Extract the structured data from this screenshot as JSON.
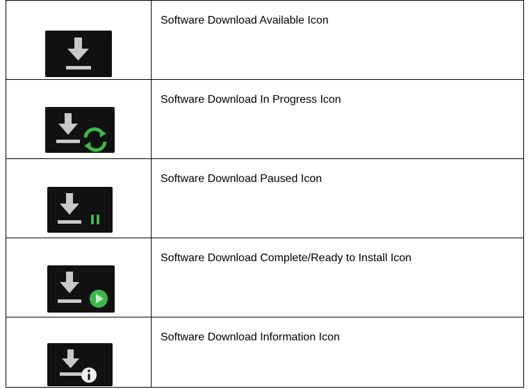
{
  "rows": [
    {
      "icon": "download-available-icon",
      "label": "Software Download Available Icon"
    },
    {
      "icon": "download-in-progress-icon",
      "label": "Software Download In Progress Icon"
    },
    {
      "icon": "download-paused-icon",
      "label": "Software Download Paused Icon"
    },
    {
      "icon": "download-complete-icon",
      "label": "Software Download Complete/Ready to Install Icon"
    },
    {
      "icon": "download-information-icon",
      "label": "Software Download Information Icon"
    }
  ],
  "colors": {
    "icon_background": "#111111",
    "arrow": "#c8c8c8",
    "status_green": "#3fb84b",
    "info_white": "#f0f0f0",
    "border": "#000000"
  }
}
